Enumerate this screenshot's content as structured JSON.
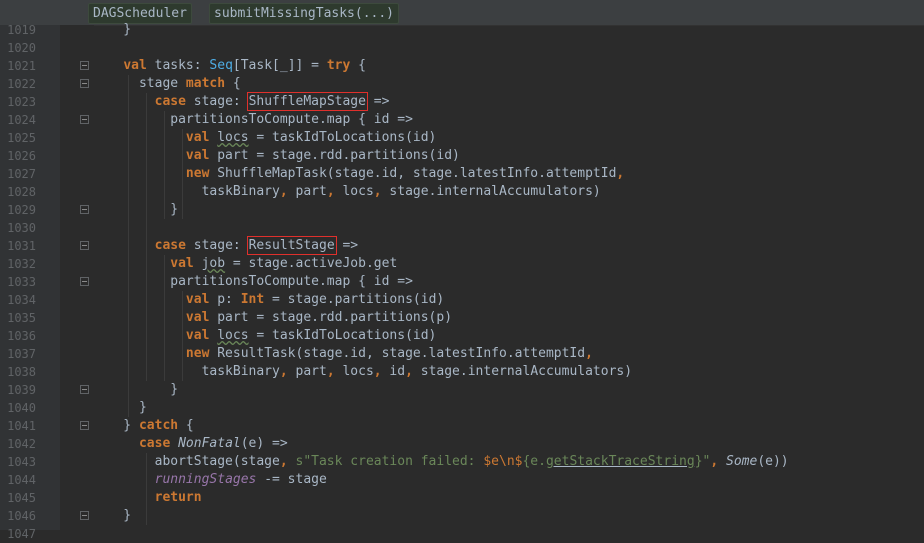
{
  "breadcrumb": {
    "class_name": "DAGScheduler",
    "method_name": "submitMissingTasks(...)"
  },
  "colors": {
    "keyword": "#cc7832",
    "string": "#6a8759",
    "field": "#9876aa",
    "highlight_box": "#e0302c"
  },
  "lines": [
    {
      "n": "1019",
      "segs": [
        [
          "p",
          "    }"
        ]
      ]
    },
    {
      "n": "1020",
      "segs": []
    },
    {
      "n": "1021",
      "segs": [
        [
          "p",
          "    "
        ],
        [
          "k",
          "val"
        ],
        [
          "p",
          " tasks: "
        ],
        [
          "t",
          "Seq"
        ],
        [
          "p",
          "[Task[_]] = "
        ],
        [
          "k",
          "try"
        ],
        [
          "p",
          " {"
        ]
      ]
    },
    {
      "n": "1022",
      "segs": [
        [
          "p",
          "      stage "
        ],
        [
          "k",
          "match"
        ],
        [
          "p",
          " {"
        ]
      ]
    },
    {
      "n": "1023",
      "segs": [
        [
          "p",
          "        "
        ],
        [
          "k",
          "case"
        ],
        [
          "p",
          " stage: "
        ],
        [
          "b",
          "ShuffleMapStage"
        ],
        [
          "p",
          " =>"
        ]
      ]
    },
    {
      "n": "1024",
      "segs": [
        [
          "p",
          "          partitionsToCompute.map { id =>"
        ]
      ]
    },
    {
      "n": "1025",
      "segs": [
        [
          "p",
          "            "
        ],
        [
          "k",
          "val"
        ],
        [
          "p",
          " "
        ],
        [
          "w",
          "locs"
        ],
        [
          "p",
          " = taskIdToLocations(id)"
        ]
      ]
    },
    {
      "n": "1026",
      "segs": [
        [
          "p",
          "            "
        ],
        [
          "k",
          "val"
        ],
        [
          "p",
          " part = stage.rdd.partitions(id)"
        ]
      ]
    },
    {
      "n": "1027",
      "segs": [
        [
          "p",
          "            "
        ],
        [
          "k",
          "new"
        ],
        [
          "p",
          " ShuffleMapTask(stage.id, stage.latestInfo.attemptId"
        ],
        [
          "k",
          ","
        ]
      ]
    },
    {
      "n": "1028",
      "segs": [
        [
          "p",
          "              taskBinary"
        ],
        [
          "k",
          ","
        ],
        [
          "p",
          " part"
        ],
        [
          "k",
          ","
        ],
        [
          "p",
          " locs"
        ],
        [
          "k",
          ","
        ],
        [
          "p",
          " stage.internalAccumulators)"
        ]
      ]
    },
    {
      "n": "1029",
      "segs": [
        [
          "p",
          "          }"
        ]
      ]
    },
    {
      "n": "1030",
      "segs": []
    },
    {
      "n": "1031",
      "segs": [
        [
          "p",
          "        "
        ],
        [
          "k",
          "case"
        ],
        [
          "p",
          " stage: "
        ],
        [
          "b",
          "ResultStage"
        ],
        [
          "p",
          " =>"
        ]
      ]
    },
    {
      "n": "1032",
      "segs": [
        [
          "p",
          "          "
        ],
        [
          "k",
          "val"
        ],
        [
          "p",
          " "
        ],
        [
          "w",
          "job"
        ],
        [
          "p",
          " = stage.activeJob.get"
        ]
      ]
    },
    {
      "n": "1033",
      "segs": [
        [
          "p",
          "          partitionsToCompute.map { id =>"
        ]
      ]
    },
    {
      "n": "1034",
      "segs": [
        [
          "p",
          "            "
        ],
        [
          "k",
          "val"
        ],
        [
          "p",
          " p: "
        ],
        [
          "k",
          "Int"
        ],
        [
          "p",
          " = stage.partitions(id)"
        ]
      ]
    },
    {
      "n": "1035",
      "segs": [
        [
          "p",
          "            "
        ],
        [
          "k",
          "val"
        ],
        [
          "p",
          " part = stage.rdd.partitions(p)"
        ]
      ]
    },
    {
      "n": "1036",
      "segs": [
        [
          "p",
          "            "
        ],
        [
          "k",
          "val"
        ],
        [
          "p",
          " "
        ],
        [
          "w",
          "locs"
        ],
        [
          "p",
          " = taskIdToLocations(id)"
        ]
      ]
    },
    {
      "n": "1037",
      "segs": [
        [
          "p",
          "            "
        ],
        [
          "k",
          "new"
        ],
        [
          "p",
          " ResultTask(stage.id, stage.latestInfo.attemptId"
        ],
        [
          "k",
          ","
        ]
      ]
    },
    {
      "n": "1038",
      "segs": [
        [
          "p",
          "              taskBinary"
        ],
        [
          "k",
          ","
        ],
        [
          "p",
          " part"
        ],
        [
          "k",
          ","
        ],
        [
          "p",
          " locs"
        ],
        [
          "k",
          ","
        ],
        [
          "p",
          " id"
        ],
        [
          "k",
          ","
        ],
        [
          "p",
          " stage.internalAccumulators)"
        ]
      ]
    },
    {
      "n": "1039",
      "segs": [
        [
          "p",
          "          }"
        ]
      ]
    },
    {
      "n": "1040",
      "segs": [
        [
          "p",
          "      }"
        ]
      ]
    },
    {
      "n": "1041",
      "segs": [
        [
          "p",
          "    } "
        ],
        [
          "k",
          "catch"
        ],
        [
          "p",
          " {"
        ]
      ]
    },
    {
      "n": "1042",
      "segs": [
        [
          "p",
          "      "
        ],
        [
          "k",
          "case"
        ],
        [
          "p",
          " "
        ],
        [
          "i",
          "NonFatal"
        ],
        [
          "p",
          "(e) =>"
        ]
      ]
    },
    {
      "n": "1043",
      "segs": [
        [
          "p",
          "        abortStage(stage"
        ],
        [
          "k",
          ","
        ],
        [
          "p",
          " "
        ],
        [
          "s",
          "s\"Task creation failed: "
        ],
        [
          "e",
          "$e\\n$"
        ],
        [
          "s",
          "{e."
        ],
        [
          "u",
          "getStackTraceString"
        ],
        [
          "s",
          "}\""
        ],
        [
          "k",
          ","
        ],
        [
          "p",
          " "
        ],
        [
          "i",
          "Some"
        ],
        [
          "p",
          "(e))"
        ]
      ]
    },
    {
      "n": "1044",
      "segs": [
        [
          "p",
          "        "
        ],
        [
          "f",
          "runningStages"
        ],
        [
          "p",
          " -= stage"
        ]
      ]
    },
    {
      "n": "1045",
      "segs": [
        [
          "p",
          "        "
        ],
        [
          "k",
          "return"
        ]
      ]
    },
    {
      "n": "1046",
      "segs": [
        [
          "p",
          "    }"
        ]
      ]
    },
    {
      "n": "1047",
      "segs": []
    }
  ]
}
